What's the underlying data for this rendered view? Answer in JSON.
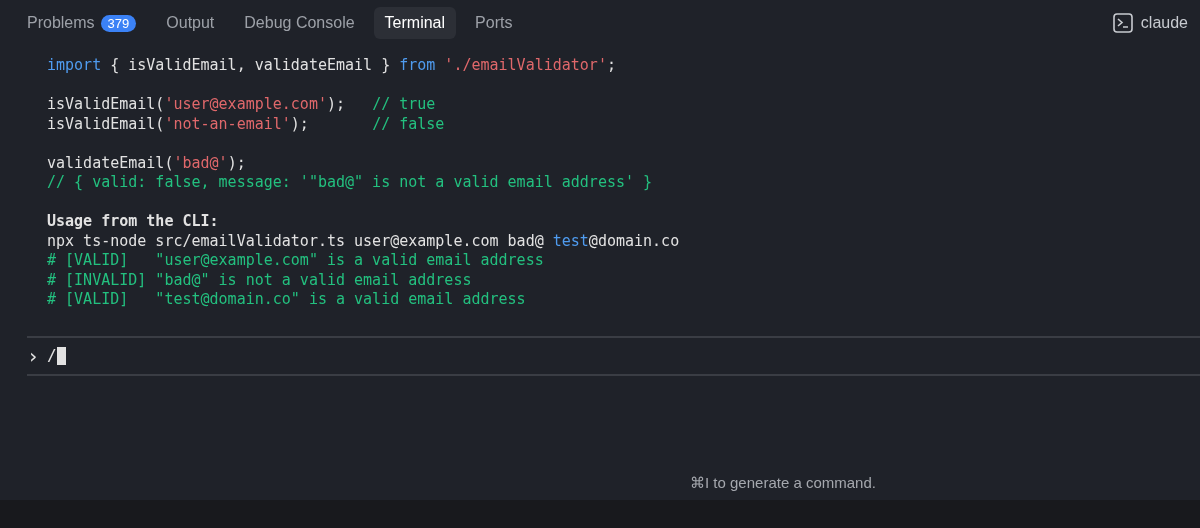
{
  "tabs": [
    {
      "label": "Problems",
      "badge": "379",
      "selected": false
    },
    {
      "label": "Output",
      "selected": false
    },
    {
      "label": "Debug Console",
      "selected": false
    },
    {
      "label": "Terminal",
      "selected": true
    },
    {
      "label": "Ports",
      "selected": false
    }
  ],
  "terminal_selector": {
    "label": "claude"
  },
  "output_blocks": [
    {
      "lines": [
        {
          "bold": false,
          "segments": [
            {
              "kind": "keyword",
              "text": "import"
            },
            {
              "kind": "plain",
              "text": " { isValidEmail, validateEmail } "
            },
            {
              "kind": "keyword",
              "text": "from "
            },
            {
              "kind": "string",
              "text": "'./emailValidator'"
            },
            {
              "kind": "plain",
              "text": ";"
            }
          ]
        }
      ]
    },
    {
      "lines": [
        {
          "bold": false,
          "segments": [
            {
              "kind": "plain",
              "text": "isValidEmail("
            },
            {
              "kind": "string",
              "text": "'user@example.com'"
            },
            {
              "kind": "plain",
              "text": ");   "
            },
            {
              "kind": "comment",
              "text": "// true"
            }
          ]
        },
        {
          "bold": false,
          "segments": [
            {
              "kind": "plain",
              "text": "isValidEmail("
            },
            {
              "kind": "string",
              "text": "'not-an-email'"
            },
            {
              "kind": "plain",
              "text": ");       "
            },
            {
              "kind": "comment",
              "text": "// false"
            }
          ]
        }
      ]
    },
    {
      "lines": [
        {
          "bold": false,
          "segments": [
            {
              "kind": "plain",
              "text": "validateEmail("
            },
            {
              "kind": "string",
              "text": "'bad@'"
            },
            {
              "kind": "plain",
              "text": ");"
            }
          ]
        },
        {
          "bold": false,
          "segments": [
            {
              "kind": "comment",
              "text": "// { valid: false, message: '\"bad@\" is not a valid email address' }"
            }
          ]
        }
      ]
    },
    {
      "lines": [
        {
          "bold": true,
          "segments": [
            {
              "kind": "plain",
              "text": "Usage from the CLI:"
            }
          ]
        },
        {
          "bold": false,
          "segments": [
            {
              "kind": "plain",
              "text": "npx ts-node src/emailValidator.ts user@example.com bad@ "
            },
            {
              "kind": "keyword",
              "text": "test"
            },
            {
              "kind": "plain",
              "text": "@domain.co"
            }
          ]
        },
        {
          "bold": false,
          "segments": [
            {
              "kind": "comment",
              "text": "# [VALID]   \"user@example.com\" is a valid email address"
            }
          ]
        },
        {
          "bold": false,
          "segments": [
            {
              "kind": "comment",
              "text": "# [INVALID] \"bad@\" is not a valid email address"
            }
          ]
        },
        {
          "bold": false,
          "segments": [
            {
              "kind": "comment",
              "text": "# [VALID]   \"test@domain.co\" is a valid email address"
            }
          ]
        }
      ]
    }
  ],
  "prompt": {
    "symbol": "›",
    "value": "/"
  },
  "hint": "⌘I to generate a command."
}
